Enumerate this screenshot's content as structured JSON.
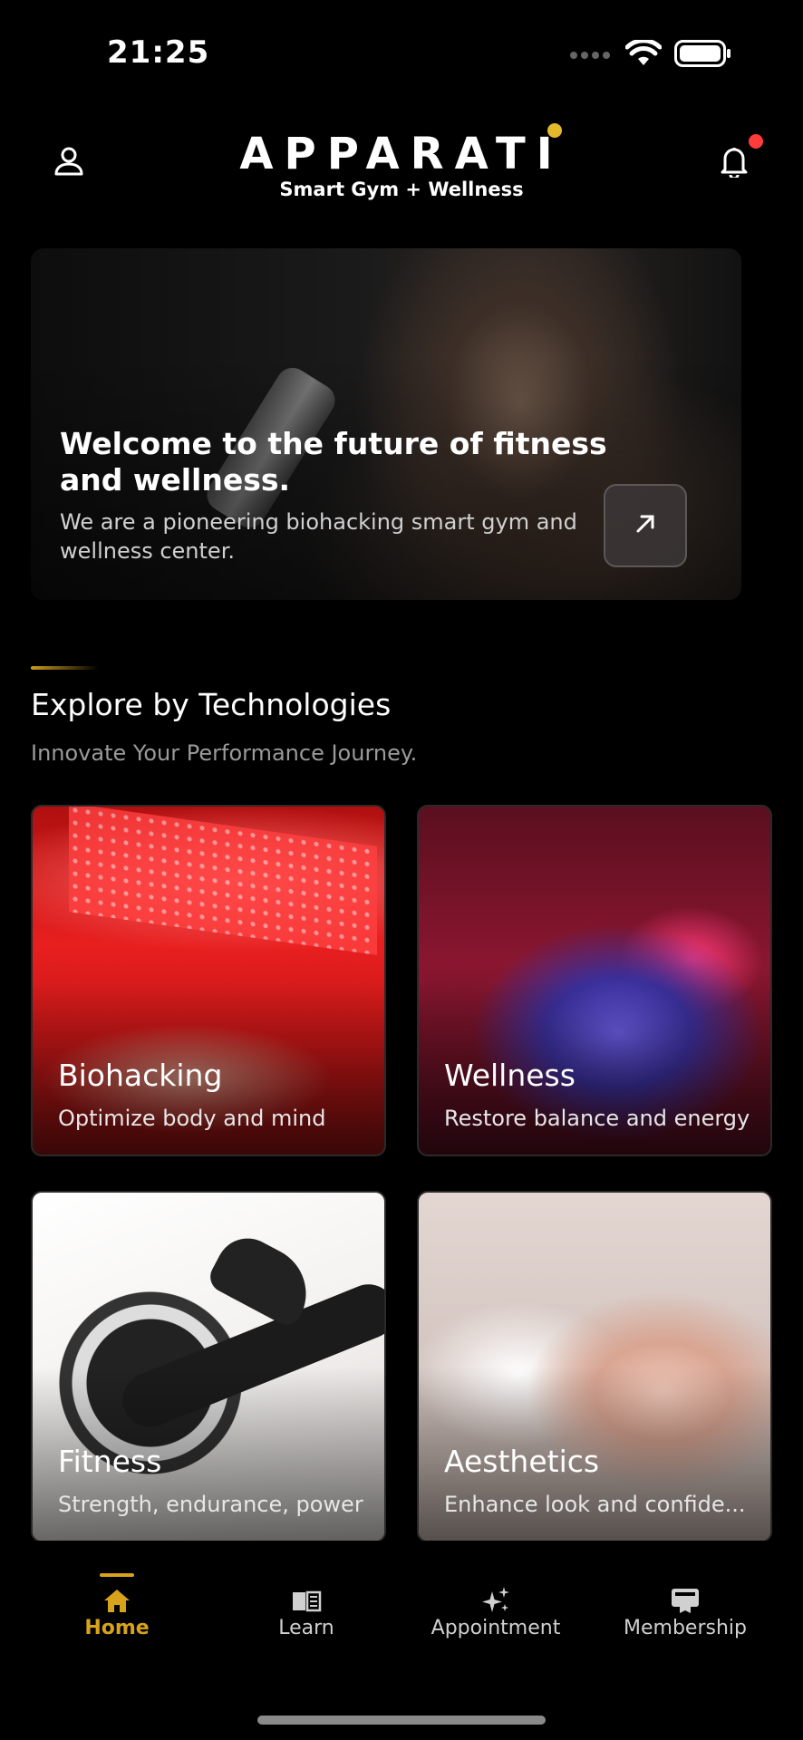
{
  "status_bar": {
    "time": "21:25"
  },
  "header": {
    "logo_word": "APPARATI",
    "logo_tagline": "Smart Gym + Wellness",
    "profile_icon": "user-icon",
    "bell_icon": "bell-icon",
    "notification_dot_color": "#ff3b3b"
  },
  "hero": {
    "title": "Welcome to the future of fitness and wellness.",
    "subtitle": "We are a pioneering biohacking smart gym and wellness center.",
    "action_icon": "arrow-up-right-icon"
  },
  "section": {
    "title": "Explore by Technologies",
    "subtitle": "Innovate Your Performance Journey."
  },
  "cards": [
    {
      "title": "Biohacking",
      "subtitle": "Optimize body and mind"
    },
    {
      "title": "Wellness",
      "subtitle": "Restore balance and energy"
    },
    {
      "title": "Fitness",
      "subtitle": "Strength, endurance, power"
    },
    {
      "title": "Aesthetics",
      "subtitle": "Enhance look and confide..."
    }
  ],
  "tabs": [
    {
      "label": "Home",
      "icon": "home-icon",
      "active": true
    },
    {
      "label": "Learn",
      "icon": "book-icon",
      "active": false
    },
    {
      "label": "Appointment",
      "icon": "sparkles-icon",
      "active": false
    },
    {
      "label": "Membership",
      "icon": "membership-card-icon",
      "active": false
    }
  ],
  "colors": {
    "accent": "#d7a21c",
    "background": "#000000"
  }
}
